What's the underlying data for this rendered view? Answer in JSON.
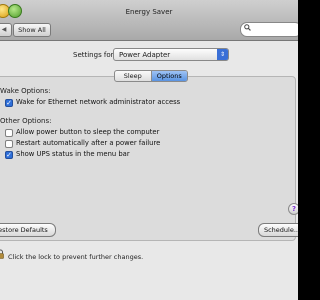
{
  "window": {
    "title": "Energy Saver"
  },
  "toolbar": {
    "back_label": "◀",
    "show_all_label": "Show All",
    "search_placeholder": ""
  },
  "settings": {
    "label": "Settings for:",
    "selected_value": "Power Adapter"
  },
  "tabs": [
    {
      "label": "Sleep"
    },
    {
      "label": "Options"
    }
  ],
  "wake_options": {
    "title": "Wake Options:",
    "items": [
      {
        "label": "Wake for Ethernet network administrator access",
        "checked": true
      }
    ]
  },
  "other_options": {
    "title": "Other Options:",
    "items": [
      {
        "label": "Allow power button to sleep the computer",
        "checked": false
      },
      {
        "label": "Restart automatically after a power failure",
        "checked": false
      },
      {
        "label": "Show UPS status in the menu bar",
        "checked": true
      }
    ]
  },
  "buttons": {
    "restore_defaults": "estore Defaults",
    "schedule": "Schedule..."
  },
  "help": {
    "label": "?"
  },
  "lock": {
    "text": "Click the lock to prevent further changes."
  },
  "colors": {
    "accent": "#3a6fd6",
    "help_icon": "#7c2fd0"
  }
}
